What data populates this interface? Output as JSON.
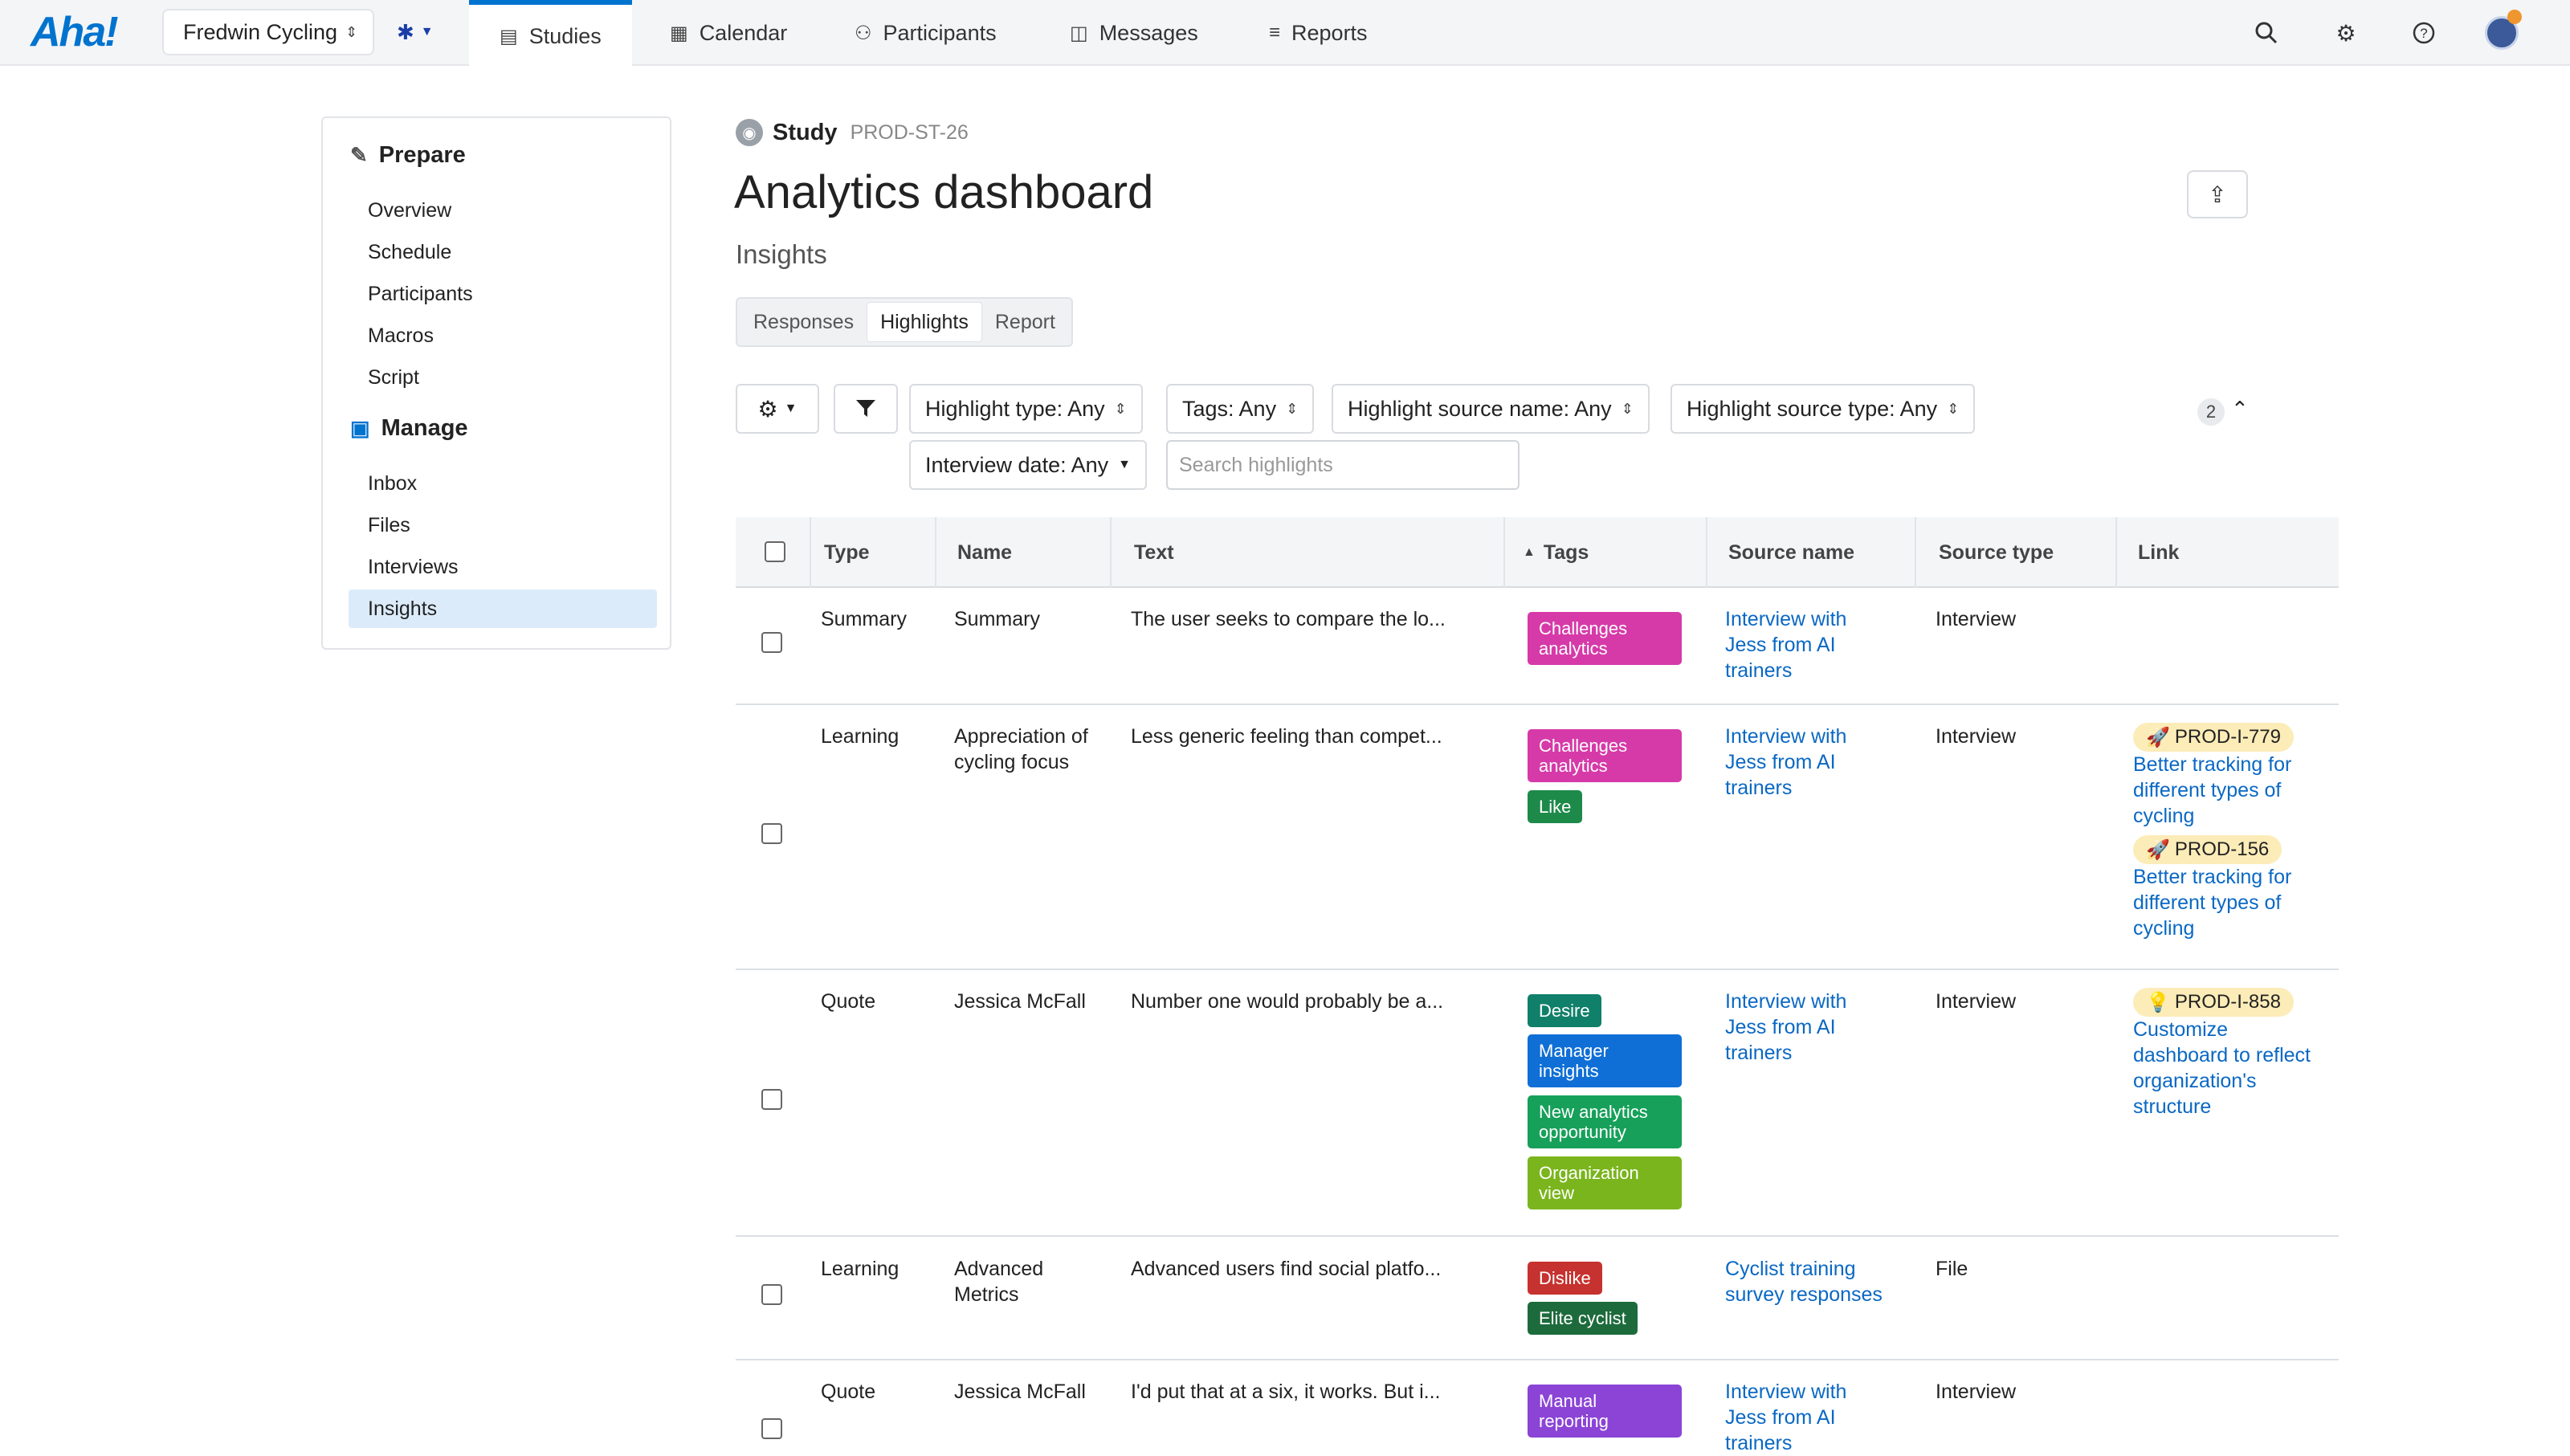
{
  "app": {
    "logo": "Aha!",
    "workspace": "Fredwin Cycling",
    "nav_tabs": [
      {
        "label": "Studies",
        "icon": "studies-icon"
      },
      {
        "label": "Calendar",
        "icon": "calendar-icon"
      },
      {
        "label": "Participants",
        "icon": "participants-icon"
      },
      {
        "label": "Messages",
        "icon": "messages-icon"
      },
      {
        "label": "Reports",
        "icon": "reports-icon"
      }
    ],
    "active_tab": "Studies",
    "accent_color": "#0073cf"
  },
  "sidebar": {
    "prepare_heading": "Prepare",
    "prepare_items": [
      "Overview",
      "Schedule",
      "Participants",
      "Macros",
      "Script"
    ],
    "manage_heading": "Manage",
    "manage_items": [
      "Inbox",
      "Files",
      "Interviews",
      "Insights"
    ],
    "active_item": "Insights"
  },
  "header": {
    "study_label": "Study",
    "study_code": "PROD-ST-26",
    "title": "Analytics dashboard",
    "subtitle": "Insights"
  },
  "view_tabs": [
    "Responses",
    "Highlights",
    "Report"
  ],
  "active_view_tab": "Highlights",
  "filters": {
    "highlight_type": "Highlight type: Any",
    "tags": "Tags: Any",
    "source_name": "Highlight source name: Any",
    "source_type": "Highlight source type: Any",
    "interview_date": "Interview date: Any",
    "search_placeholder": "Search highlights",
    "count": "2"
  },
  "table": {
    "columns": [
      "Type",
      "Name",
      "Text",
      "Tags",
      "Source name",
      "Source type",
      "Link"
    ],
    "sorted_column": "Tags",
    "rows": [
      {
        "type": "Summary",
        "name": "Summary",
        "text": "The user seeks to compare the lo...",
        "tags": [
          {
            "label": "Challenges analytics",
            "color": "#d63aa8"
          }
        ],
        "source_name": "Interview with Jess from AI trainers",
        "source_type": "Interview",
        "links": []
      },
      {
        "type": "Learning",
        "name": "Appreciation of cycling focus",
        "text": "Less generic feeling than compet...",
        "tags": [
          {
            "label": "Challenges analytics",
            "color": "#d63aa8"
          },
          {
            "label": "Like",
            "color": "#1e8a4a"
          }
        ],
        "source_name": "Interview with Jess from AI trainers",
        "source_type": "Interview",
        "links": [
          {
            "id": "PROD-I-779",
            "icon": "rocket-icon",
            "title": "Better tracking for different types of cycling"
          },
          {
            "id": "PROD-156",
            "icon": "rocket-icon",
            "title": "Better tracking for different types of cycling"
          }
        ]
      },
      {
        "type": "Quote",
        "name": "Jessica McFall",
        "text": "Number one would probably be a...",
        "tags": [
          {
            "label": "Desire",
            "color": "#11806a"
          },
          {
            "label": "Manager insights",
            "color": "#0f6fd6"
          },
          {
            "label": "New analytics opportunity",
            "color": "#17a05a"
          },
          {
            "label": "Organization view",
            "color": "#7ab51d"
          }
        ],
        "source_name": "Interview with Jess from AI trainers",
        "source_type": "Interview",
        "links": [
          {
            "id": "PROD-I-858",
            "icon": "lightbulb-icon",
            "title": "Customize dashboard to reflect organization's structure"
          }
        ]
      },
      {
        "type": "Learning",
        "name": "Advanced Metrics",
        "text": "Advanced users find social platfo...",
        "tags": [
          {
            "label": "Dislike",
            "color": "#c6322f"
          },
          {
            "label": "Elite cyclist",
            "color": "#1d6b3c"
          }
        ],
        "source_name": "Cyclist training survey responses",
        "source_type": "File",
        "links": []
      },
      {
        "type": "Quote",
        "name": "Jessica McFall",
        "text": "I'd put that at a six, it works. But i...",
        "tags": [
          {
            "label": "Manual reporting",
            "color": "#8b44d6"
          }
        ],
        "source_name": "Interview with Jess from AI trainers",
        "source_type": "Interview",
        "links": []
      }
    ]
  }
}
